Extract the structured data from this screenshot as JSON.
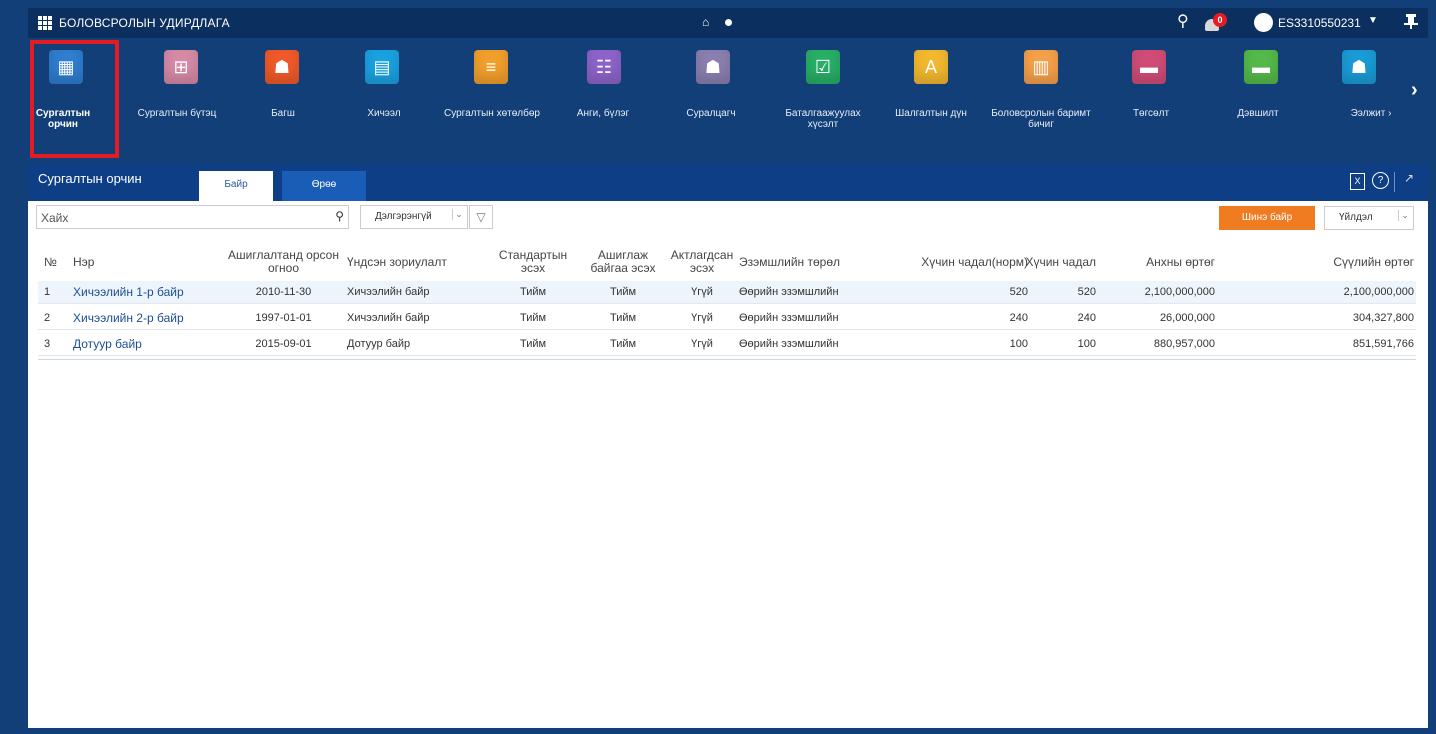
{
  "app": {
    "title": "БОЛОВСРОЛЫН УДИРДЛАГА",
    "notifications": "0",
    "user": "ES3310550231"
  },
  "ribbon": {
    "items": [
      {
        "label": "Сургалтын орчин",
        "color": "#2e7dcf",
        "glyph": "▦"
      },
      {
        "label": "Сургалтын бүтэц",
        "color": "#d68aa6",
        "glyph": "⊞"
      },
      {
        "label": "Багш",
        "color": "#f0592a",
        "glyph": "☗"
      },
      {
        "label": "Хичээл",
        "color": "#1aa1e0",
        "glyph": "▤"
      },
      {
        "label": "Сургалтын хөтөлбөр",
        "color": "#f19f2b",
        "glyph": "≡"
      },
      {
        "label": "Анги, бүлэг",
        "color": "#8d63c9",
        "glyph": "☷"
      },
      {
        "label": "Суралцагч",
        "color": "#8a7fb0",
        "glyph": "☗"
      },
      {
        "label": "Баталгаажуулах хүсэлт",
        "color": "#28ae67",
        "glyph": "☑"
      },
      {
        "label": "Шалгалтын дүн",
        "color": "#f2b82f",
        "glyph": "A"
      },
      {
        "label": "Боловсролын баримт бичиг",
        "color": "#f5a04a",
        "glyph": "▥"
      },
      {
        "label": "Төгсөлт",
        "color": "#d04c77",
        "glyph": "▬"
      },
      {
        "label": "Дэвшилт",
        "color": "#54b949",
        "glyph": "▬"
      },
      {
        "label": "Ээлжит ›",
        "color": "#1a9bd6",
        "glyph": "☗"
      }
    ]
  },
  "panel": {
    "title": "Сургалтын орчин",
    "tabs": [
      "Байр",
      "Өрөө"
    ],
    "search_placeholder": "Хайх",
    "filter": "Дэлгэрэнгүй",
    "new_button": "Шинэ байр",
    "action_button": "Үйлдэл"
  },
  "table": {
    "headers": [
      "№",
      "Нэр",
      "Ашиглалтанд орсон огноо",
      "Үндсэн зориулалт",
      "Стандартын эсэх",
      "Ашиглаж байгаа эсэх",
      "Актлагдсан эсэх",
      "Эзэмшлийн төрөл",
      "Хүчин чадал(норм)",
      "Хүчин чадал",
      "Анхны өртөг",
      "Сүүлийн өртөг"
    ],
    "rows": [
      [
        "1",
        "Хичээлийн 1-р байр",
        "2010-11-30",
        "Хичээлийн байр",
        "Тийм",
        "Тийм",
        "Үгүй",
        "Өөрийн эзэмшлийн",
        "520",
        "520",
        "2,100,000,000",
        "2,100,000,000"
      ],
      [
        "2",
        "Хичээлийн 2-р байр",
        "1997-01-01",
        "Хичээлийн байр",
        "Тийм",
        "Тийм",
        "Үгүй",
        "Өөрийн эзэмшлийн",
        "240",
        "240",
        "26,000,000",
        "304,327,800"
      ],
      [
        "3",
        "Дотуур байр",
        "2015-09-01",
        "Дотуур байр",
        "Тийм",
        "Тийм",
        "Үгүй",
        "Өөрийн эзэмшлийн",
        "100",
        "100",
        "880,957,000",
        "851,591,766"
      ]
    ]
  }
}
